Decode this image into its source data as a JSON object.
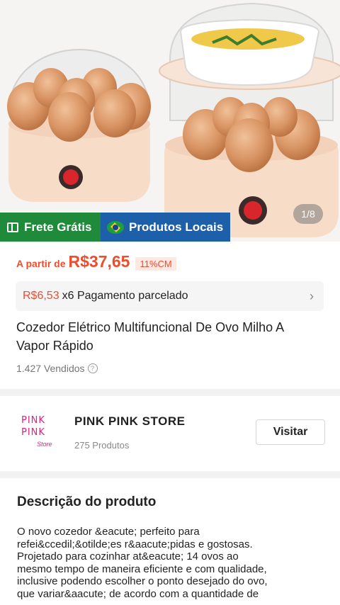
{
  "gallery": {
    "counter": "1/8",
    "image_alt": "egg-cooker-product-photo"
  },
  "badges": {
    "frete": "Frete Grátis",
    "local": "Produtos Locais"
  },
  "pricing": {
    "prefix": "A partir de",
    "price": "R$37,65",
    "discount": "11%CM",
    "installment_amount": "R$6,53",
    "installment_text": "x6 Pagamento parcelado"
  },
  "product": {
    "title": "Cozedor Elétrico Multifuncional De Ovo Milho A Vapor Rápido",
    "sold": "1.427 Vendidos"
  },
  "store": {
    "logo_line1": "PINK",
    "logo_line2": "PINK",
    "logo_line3": "Store",
    "name": "PINK PINK STORE",
    "products": "275 Produtos",
    "visit_label": "Visitar"
  },
  "description": {
    "title": "Descrição do produto",
    "text": "O novo cozedor &eacute; perfeito para\nrefei&ccedil;&otilde;es r&aacute;pidas e gostosas.\nProjetado para cozinhar at&eacute; 14 ovos ao\nmesmo tempo de maneira eficiente e com qualidade,\ninclusive podendo escolher o ponto desejado do ovo,\nque variar&aacute; de acordo com a quantidade de"
  },
  "colors": {
    "accent": "#ee4d2d",
    "frete_green": "#1f8a3a",
    "local_blue": "#1d5fa8"
  }
}
